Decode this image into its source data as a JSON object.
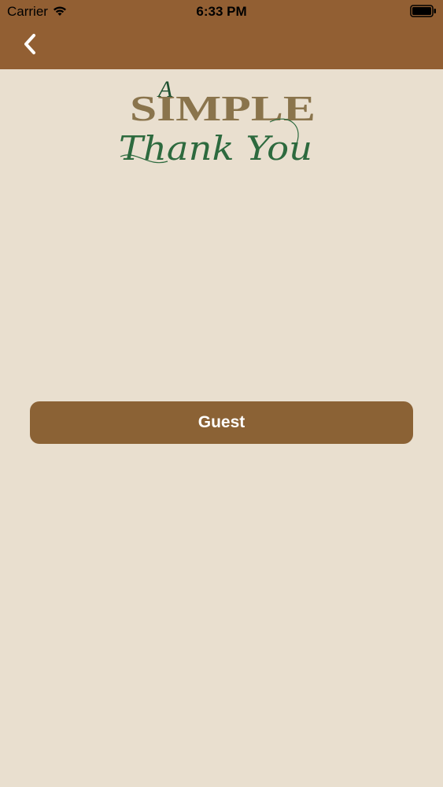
{
  "status_bar": {
    "carrier": "Carrier",
    "time": "6:33 PM",
    "wifi_icon": "wifi-icon",
    "battery_icon": "battery-icon"
  },
  "nav": {
    "back_icon": "chevron-left-icon"
  },
  "logo": {
    "line1": "A",
    "line2": "SIMPLE",
    "line3": "Thank You"
  },
  "actions": {
    "guest_label": "Guest"
  },
  "colors": {
    "header": "#925f33",
    "background": "#e9dfcf",
    "button": "#8b6235",
    "logo_gold": "#8a744c",
    "logo_green": "#2d6a3e"
  }
}
